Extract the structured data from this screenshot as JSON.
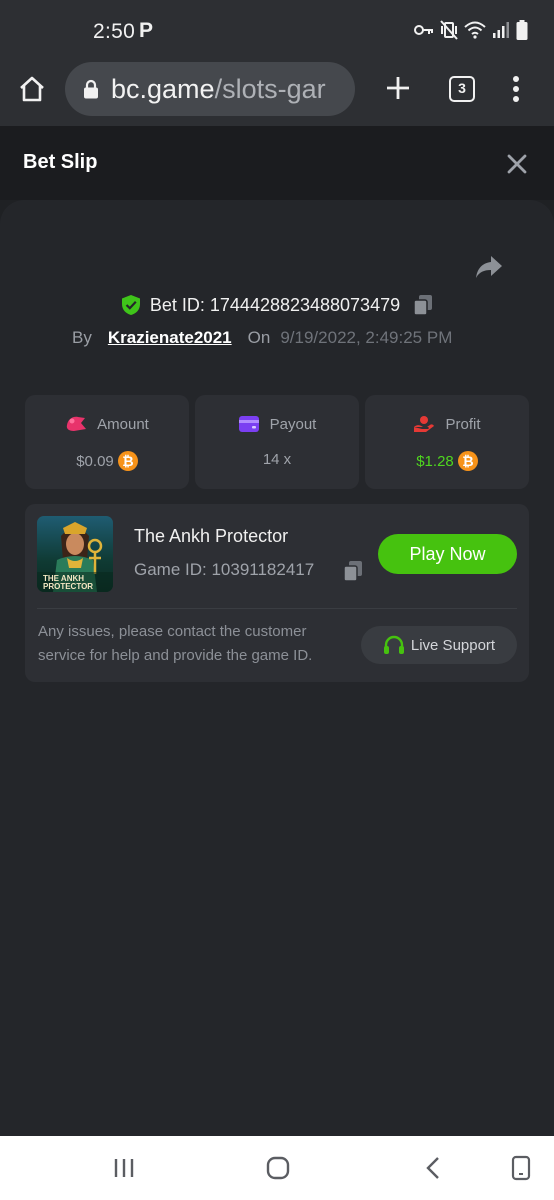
{
  "status_bar": {
    "time": "2:50",
    "notification_glyph": "P",
    "icons": [
      "key-icon",
      "vibrate-mute-icon",
      "wifi-icon",
      "signal-icon",
      "battery-icon"
    ]
  },
  "browser": {
    "url_domain": "bc.game",
    "url_path": "/slots-gar",
    "tab_count": "3"
  },
  "slip": {
    "title": "Bet Slip",
    "bet_id": "Bet ID: 1744428823488073479",
    "by_label": "By",
    "username": "Krazienate2021",
    "on_label": "On",
    "date": "9/19/2022, 2:49:25 PM"
  },
  "stats": {
    "amount": {
      "label": "Amount",
      "value": "$0.09"
    },
    "payout": {
      "label": "Payout",
      "value": "14 x"
    },
    "profit": {
      "label": "Profit",
      "value": "$1.28"
    }
  },
  "game": {
    "title": "The Ankh Protector",
    "game_id": "Game ID: 10391182417",
    "play_label": "Play Now",
    "thumb_text_line1": "THE ANKH",
    "thumb_text_line2": "PROTECTOR",
    "support_text": "Any issues, please contact the customer service for help and provide the game ID.",
    "support_label": "Live Support"
  },
  "colors": {
    "background": "#1f2124",
    "panel": "#24262a",
    "card": "#2d2f34",
    "accent_green": "#46c20f",
    "profit_green": "#4fd61f",
    "coin_orange": "#f7931a",
    "amount_pink": "#e8336b",
    "payout_purple": "#7b3ff2",
    "profit_red": "#e53935"
  }
}
